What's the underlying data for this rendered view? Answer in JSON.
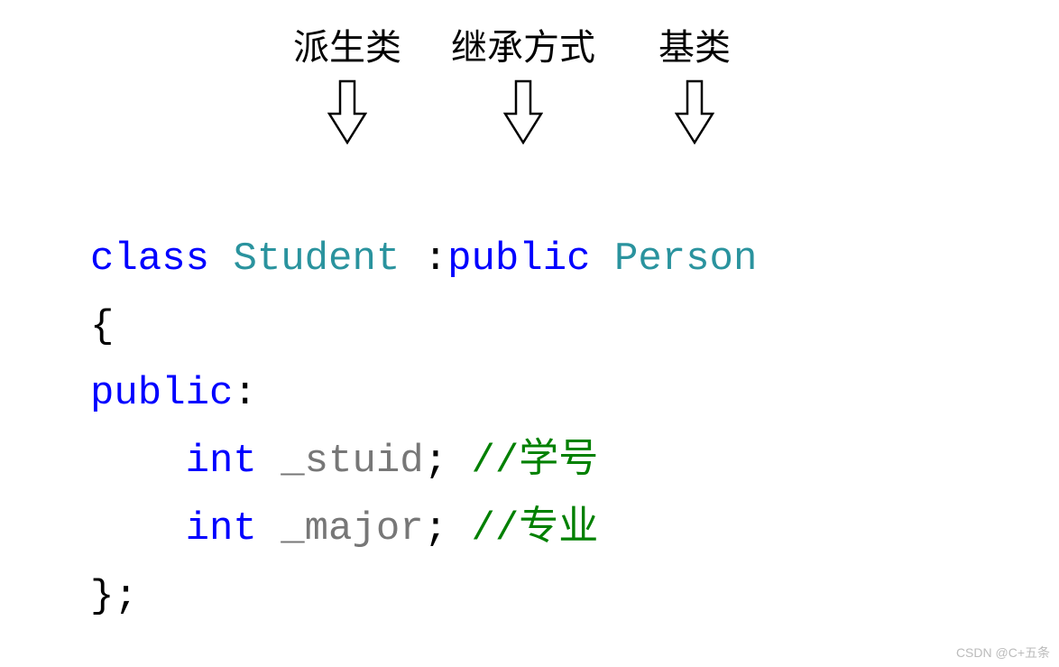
{
  "labels": {
    "derived": "派生类",
    "inherit_mode": "继承方式",
    "base": "基类"
  },
  "code": {
    "line1": {
      "class_kw": "class",
      "space": " ",
      "derived_name": "Student",
      "sep": " :",
      "access": "public",
      "sp2": " ",
      "base_name": "Person"
    },
    "line2": "{",
    "line3": {
      "access": "public",
      "colon": ":"
    },
    "line4": {
      "indent": "    ",
      "type": "int",
      "sp": " ",
      "name": "_stuid",
      "semi": "; ",
      "comment": "//学号"
    },
    "line5": {
      "indent": "    ",
      "type": "int",
      "sp": " ",
      "name": "_major",
      "semi": "; ",
      "comment": "//专业"
    },
    "line6": "};"
  },
  "watermark": "CSDN @C+五条"
}
